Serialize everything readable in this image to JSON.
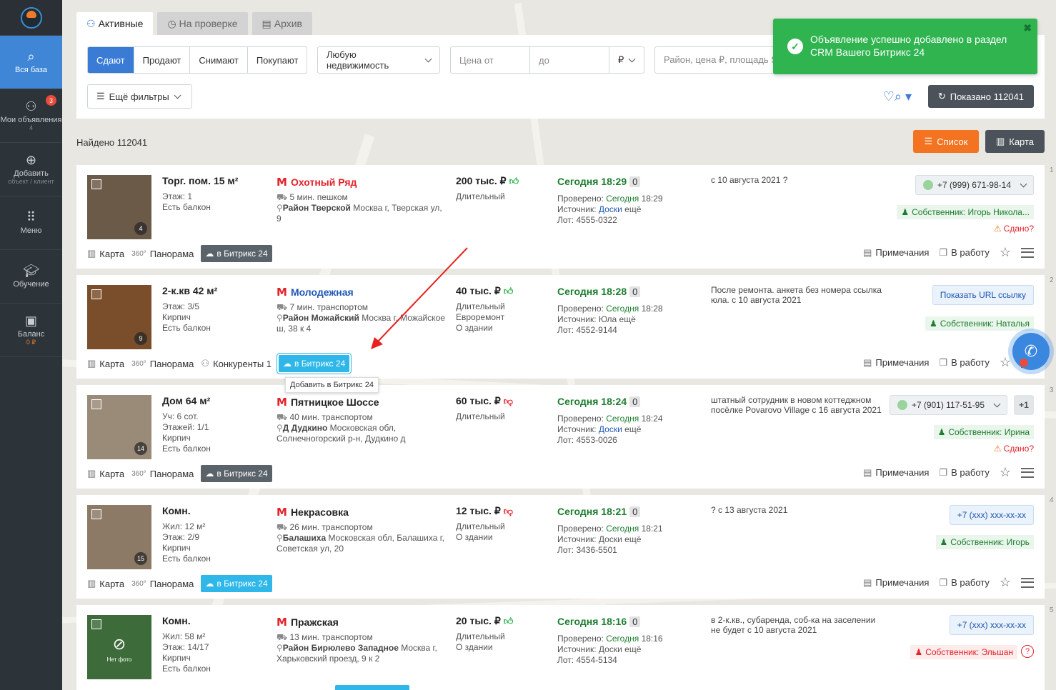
{
  "sidebar": {
    "items": [
      {
        "label": "Вся база",
        "sub": "",
        "icon": "search-doc-icon",
        "active": true
      },
      {
        "label": "Мои объявления",
        "sub": "4",
        "icon": "users-icon",
        "badge": "3"
      },
      {
        "label": "Добавить",
        "sub": "объект / клиент",
        "icon": "plus-circle-icon"
      },
      {
        "label": "Меню",
        "sub": "",
        "icon": "grid-icon"
      },
      {
        "label": "Обучение",
        "sub": "",
        "icon": "graduation-cap-icon"
      },
      {
        "label": "Баланс",
        "sub": "0 ₽",
        "icon": "wallet-icon"
      }
    ]
  },
  "tabs": [
    {
      "label": "Активные",
      "active": true
    },
    {
      "label": "На проверке"
    },
    {
      "label": "Архив"
    }
  ],
  "filters": {
    "deal": [
      "Сдают",
      "Продают",
      "Снимают",
      "Покупают"
    ],
    "property": "Любую недвижимость",
    "price_from_placeholder": "Цена от",
    "price_to_placeholder": "до",
    "currency": "₽",
    "search_placeholder": "Район, цена ₽, площадь S",
    "more": "Ещё фильтры",
    "shown": "Показано 112041"
  },
  "toast": {
    "text": "Объявление успешно добавлено в раздел CRM Вашего Битрикс 24"
  },
  "found": "Найдено 112041",
  "view": {
    "list": "Список",
    "map": "Карта"
  },
  "labels": {
    "map": "Карта",
    "panorama": "Панорама",
    "b24": "в Битрикс 24",
    "notes": "Примечания",
    "work": "В работу",
    "deg": "360°"
  },
  "tooltip": "Добавить в Битрикс 24",
  "listings": [
    {
      "title": "Торг. пом. 15 м²",
      "info": [
        "Этаж: 1",
        "Есть балкон"
      ],
      "photos": "4",
      "metro": "Охотный Ряд",
      "metro_style": "red",
      "transit": "5 мин. пешком",
      "district": "Район Тверской",
      "address": "Москва г, Тверская ул, 9",
      "price": "200 тыс. ₽",
      "thumb": "g",
      "price_info": [
        "Длительный"
      ],
      "date": "Сегодня 18:29",
      "count": "0",
      "checked_time": "18:29",
      "source": "Доски",
      "source_link": true,
      "lot": "Лот: 4555-0322",
      "note": "с 10 августа 2021 ?",
      "phone": "+7 (999) 671-98-14",
      "owner": "Собственник: Игорь Никола...",
      "sdano": "Сдано?",
      "b24_style": "dark"
    },
    {
      "title": "2-к.кв 42 м²",
      "info": [
        "Этаж: 3/5",
        "Кирпич",
        "Есть балкон"
      ],
      "photos": "9",
      "metro": "Молодежная",
      "metro_style": "blue",
      "transit": "7 мин. транспортом",
      "district": "Район Можайский",
      "address": "Москва г, Можайское ш, 38 к 4",
      "price": "40 тыс. ₽",
      "thumb": "g",
      "price_info": [
        "Длительный",
        "Евроремонт",
        "О здании"
      ],
      "date": "Сегодня 18:28",
      "count": "0",
      "checked_time": "18:28",
      "source": "Юла",
      "source_link": false,
      "lot": "Лот: 4552-9144",
      "note": "После ремонта. анкета без номера ссылка юла. с 10 августа 2021",
      "phone": "Показать URL ссылку",
      "owner": "Собственник: Наталья",
      "competitors": "Конкуренты 1",
      "b24_style": "cyan"
    },
    {
      "title": "Дом 64 м²",
      "info": [
        "Уч: 6 сот.",
        "Этажей: 1/1",
        "Кирпич",
        "Есть балкон"
      ],
      "photos": "14",
      "metro": "Пятницкое Шоссе",
      "metro_style": "dark",
      "transit": "40 мин. транспортом",
      "district": "Д Дудкино",
      "address": "Московская обл, Солнечногорский р-н, Дудкино д",
      "price": "60 тыс. ₽",
      "thumb": "r",
      "price_info": [
        "Длительный"
      ],
      "date": "Сегодня 18:24",
      "count": "0",
      "checked_time": "18:24",
      "source": "Доски",
      "source_link": true,
      "lot": "Лот: 4553-0026",
      "note": "штатный сотрудник в новом коттеджном посёлке Povarovo Village с 16 августа 2021",
      "phone": "+7 (901) 117-51-95",
      "plus": "+1",
      "owner": "Собственник: Ирина",
      "sdano": "Сдано?",
      "b24_style": "dark"
    },
    {
      "title": "Комн.",
      "info": [
        "Жил: 12 м²",
        "Этаж: 2/9",
        "Кирпич",
        "Есть балкон"
      ],
      "photos": "15",
      "metro": "Некрасовка",
      "metro_style": "dark",
      "transit": "26 мин. транспортом",
      "district": "Балашиха",
      "address": "Московская обл, Балашиха г, Советская ул, 20",
      "price": "12 тыс. ₽",
      "thumb": "r",
      "price_info": [
        "Длительный",
        "О здании"
      ],
      "date": "Сегодня 18:21",
      "count": "0",
      "checked_time": "18:21",
      "source": "Доски",
      "source_link": false,
      "lot": "Лот: 3436-5501",
      "note": "? с 13 августа 2021",
      "phone": "+7 (xxx) xxx-xx-xx",
      "owner": "Собственник: Игорь",
      "b24_style": "cyan"
    },
    {
      "title": "Комн.",
      "info": [
        "Жил: 58 м²",
        "Этаж: 14/17",
        "Кирпич",
        "Есть балкон"
      ],
      "photos": "",
      "no_photo": "Нет фото",
      "metro": "Пражская",
      "metro_style": "dark",
      "transit": "13 мин. транспортом",
      "district": "Район Бирюлево Западное",
      "address": "Москва г, Харьковский проезд, 9 к 2",
      "price": "20 тыс. ₽",
      "thumb": "g",
      "price_info": [
        "Длительный",
        "О здании"
      ],
      "date": "Сегодня 18:16",
      "count": "0",
      "checked_time": "18:16",
      "source": "Доски",
      "source_link": false,
      "lot": "Лот: 4554-5134",
      "note": "в 2-к.кв., субаренда, соб-ка на заселении не будет с 10 августа 2021",
      "phone": "+7 (xxx) xxx-xx-xx",
      "owner": "Собственник: Эльшан",
      "owner_red": true
    }
  ],
  "row_numbers": [
    "1",
    "2",
    "3",
    "4",
    "5"
  ],
  "common": {
    "checked": "Проверено:",
    "today": "Сегодня",
    "source_label": "Источник:",
    "more": "ещё"
  },
  "colors": {
    "accent": "#3a7bd5",
    "green": "#2fb450",
    "orange": "#f47321",
    "b24": "#2eb7e8"
  }
}
